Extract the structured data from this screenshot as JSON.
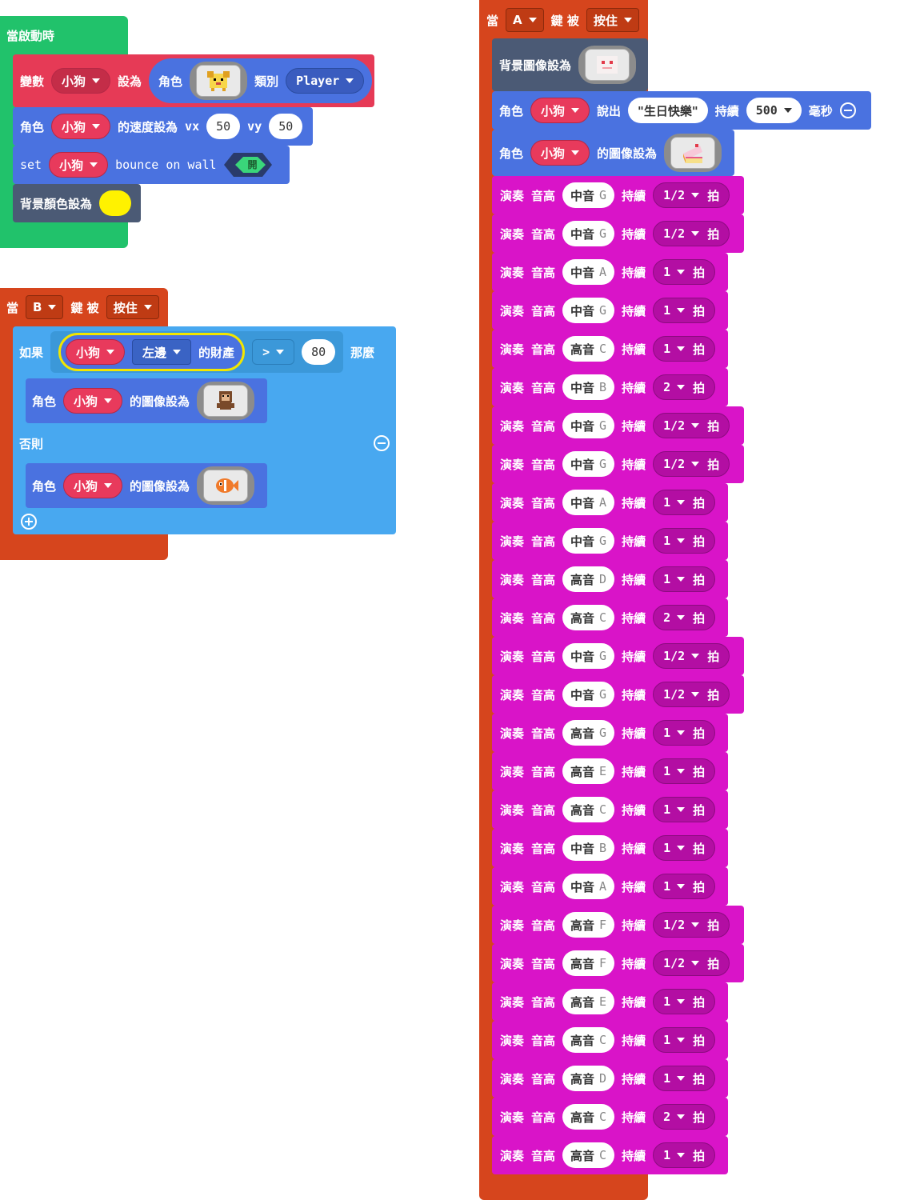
{
  "start_block": {
    "hat": "當啟動時",
    "set_var": {
      "var_label": "變數",
      "var": "小狗",
      "set_label": "設為",
      "sprite_label": "角色",
      "kind_label": "類別",
      "kind": "Player"
    },
    "velocity": {
      "label": "角色",
      "sprite": "小狗",
      "text": "的速度設為",
      "vx_label": "vx",
      "vx": "50",
      "vy_label": "vy",
      "vy": "50"
    },
    "bounce": {
      "set": "set",
      "sprite": "小狗",
      "text": "bounce on wall",
      "toggle": "開"
    },
    "bg_color": {
      "label": "背景顏色設為",
      "color": "#fff200"
    }
  },
  "b_block": {
    "when": "當",
    "key": "B",
    "key_text": "鍵 被",
    "action": "按住",
    "if_label": "如果",
    "sprite": "小狗",
    "side": "左邊",
    "prop": "的財產",
    "op": ">",
    "value": "80",
    "then": "那麼",
    "then_branch": {
      "label": "角色",
      "sprite": "小狗",
      "text": "的圖像設為"
    },
    "else_label": "否則",
    "else_branch": {
      "label": "角色",
      "sprite": "小狗",
      "text": "的圖像設為"
    }
  },
  "a_block": {
    "when": "當",
    "key": "A",
    "key_text": "鍵 被",
    "action": "按住",
    "bg_image_label": "背景圖像設為",
    "say": {
      "label": "角色",
      "sprite": "小狗",
      "say": "說出",
      "text": "\"生日快樂\"",
      "dur_label": "持續",
      "ms": "500",
      "unit": "毫秒"
    },
    "set_image": {
      "label": "角色",
      "sprite": "小狗",
      "text": "的圖像設為"
    },
    "play_label": "演奏",
    "pitch_label": "音高",
    "dur_label": "持續",
    "beat_label": "拍",
    "notes": [
      {
        "octave": "中音",
        "note": "G",
        "beat": "1/2"
      },
      {
        "octave": "中音",
        "note": "G",
        "beat": "1/2"
      },
      {
        "octave": "中音",
        "note": "A",
        "beat": "1"
      },
      {
        "octave": "中音",
        "note": "G",
        "beat": "1"
      },
      {
        "octave": "高音",
        "note": "C",
        "beat": "1"
      },
      {
        "octave": "中音",
        "note": "B",
        "beat": "2"
      },
      {
        "octave": "中音",
        "note": "G",
        "beat": "1/2"
      },
      {
        "octave": "中音",
        "note": "G",
        "beat": "1/2"
      },
      {
        "octave": "中音",
        "note": "A",
        "beat": "1"
      },
      {
        "octave": "中音",
        "note": "G",
        "beat": "1"
      },
      {
        "octave": "高音",
        "note": "D",
        "beat": "1"
      },
      {
        "octave": "高音",
        "note": "C",
        "beat": "2"
      },
      {
        "octave": "中音",
        "note": "G",
        "beat": "1/2"
      },
      {
        "octave": "中音",
        "note": "G",
        "beat": "1/2"
      },
      {
        "octave": "高音",
        "note": "G",
        "beat": "1"
      },
      {
        "octave": "高音",
        "note": "E",
        "beat": "1"
      },
      {
        "octave": "高音",
        "note": "C",
        "beat": "1"
      },
      {
        "octave": "中音",
        "note": "B",
        "beat": "1"
      },
      {
        "octave": "中音",
        "note": "A",
        "beat": "1"
      },
      {
        "octave": "高音",
        "note": "F",
        "beat": "1/2"
      },
      {
        "octave": "高音",
        "note": "F",
        "beat": "1/2"
      },
      {
        "octave": "高音",
        "note": "E",
        "beat": "1"
      },
      {
        "octave": "高音",
        "note": "C",
        "beat": "1"
      },
      {
        "octave": "高音",
        "note": "D",
        "beat": "1"
      },
      {
        "octave": "高音",
        "note": "C",
        "beat": "2"
      },
      {
        "octave": "高音",
        "note": "C",
        "beat": "1"
      }
    ]
  },
  "colors": {
    "green": "#21c26b",
    "variable": "#e63a56",
    "sprite": "#4a72e0",
    "scene": "#4b5a75",
    "event": "#d6451d",
    "logic": "#48a8f0",
    "music": "#d914c8"
  },
  "icons": [
    "dog-sprite-icon",
    "toggle-on-icon",
    "monkey-sprite-icon",
    "fish-sprite-icon",
    "cake-sprite-icon",
    "love-background-icon",
    "minus-circle-icon",
    "plus-circle-icon"
  ]
}
